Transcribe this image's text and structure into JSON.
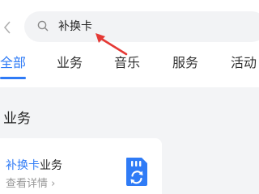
{
  "search": {
    "query": "补换卡"
  },
  "tabs": [
    {
      "label": "全部",
      "active": true
    },
    {
      "label": "业务",
      "active": false
    },
    {
      "label": "音乐",
      "active": false
    },
    {
      "label": "服务",
      "active": false
    },
    {
      "label": "活动",
      "active": false
    }
  ],
  "section": {
    "title": "业务"
  },
  "result_card": {
    "title_highlight": "补换卡",
    "title_rest": "业务",
    "link_label": "查看详情",
    "link_chevron": "›",
    "icon": "sim-card-refresh-icon"
  },
  "annotation": {
    "arrow_color": "#e53935"
  },
  "colors": {
    "accent": "#2f7bf6",
    "background": "#f3f4f6"
  }
}
